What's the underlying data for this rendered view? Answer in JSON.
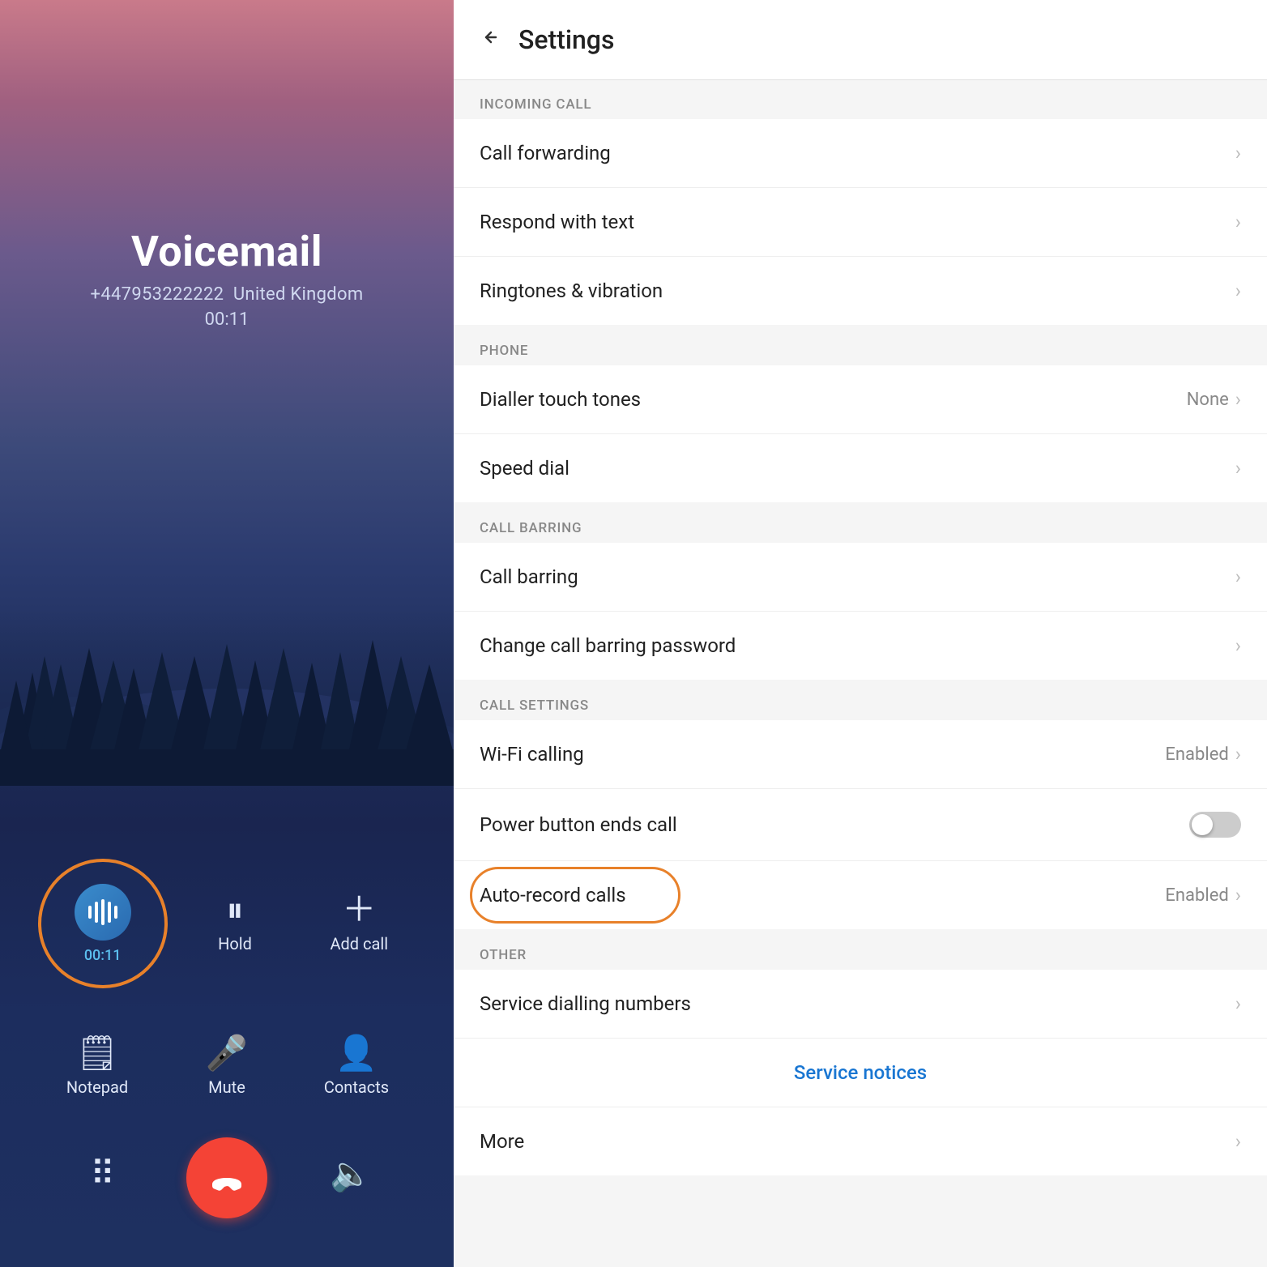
{
  "call": {
    "caller_name": "Voicemail",
    "caller_number": "+447953222222",
    "caller_location": "United Kingdom",
    "call_duration": "00:11",
    "timer_display": "00:11",
    "buttons": {
      "hold_label": "Hold",
      "add_call_label": "Add call",
      "notepad_label": "Notepad",
      "mute_label": "Mute",
      "contacts_label": "Contacts"
    }
  },
  "settings": {
    "title": "Settings",
    "back_label": "←",
    "sections": [
      {
        "id": "incoming_call",
        "header": "INCOMING CALL",
        "items": [
          {
            "id": "call_forwarding",
            "label": "Call forwarding",
            "value": "",
            "type": "nav"
          },
          {
            "id": "respond_with_text",
            "label": "Respond with text",
            "value": "",
            "type": "nav"
          },
          {
            "id": "ringtones_vibration",
            "label": "Ringtones & vibration",
            "value": "",
            "type": "nav"
          }
        ]
      },
      {
        "id": "phone",
        "header": "PHONE",
        "items": [
          {
            "id": "dialler_touch_tones",
            "label": "Dialler touch tones",
            "value": "None",
            "type": "nav"
          },
          {
            "id": "speed_dial",
            "label": "Speed dial",
            "value": "",
            "type": "nav"
          }
        ]
      },
      {
        "id": "call_barring",
        "header": "CALL BARRING",
        "items": [
          {
            "id": "call_barring",
            "label": "Call barring",
            "value": "",
            "type": "nav"
          },
          {
            "id": "change_call_barring_password",
            "label": "Change call barring password",
            "value": "",
            "type": "nav"
          }
        ]
      },
      {
        "id": "call_settings",
        "header": "CALL SETTINGS",
        "items": [
          {
            "id": "wifi_calling",
            "label": "Wi-Fi calling",
            "value": "Enabled",
            "type": "nav"
          },
          {
            "id": "power_button_ends_call",
            "label": "Power button ends call",
            "value": "",
            "type": "toggle",
            "toggle_on": false
          },
          {
            "id": "auto_record_calls",
            "label": "Auto-record calls",
            "value": "Enabled",
            "type": "nav",
            "highlighted": true
          }
        ]
      },
      {
        "id": "other",
        "header": "OTHER",
        "items": [
          {
            "id": "service_dialling_numbers",
            "label": "Service dialling numbers",
            "value": "",
            "type": "nav"
          },
          {
            "id": "service_notices",
            "label": "Service notices",
            "value": "",
            "type": "center_link"
          },
          {
            "id": "more",
            "label": "More",
            "value": "",
            "type": "nav"
          }
        ]
      }
    ]
  },
  "colors": {
    "accent_orange": "#e8812a",
    "primary_blue": "#1976d2",
    "end_call_red": "#f44336"
  }
}
